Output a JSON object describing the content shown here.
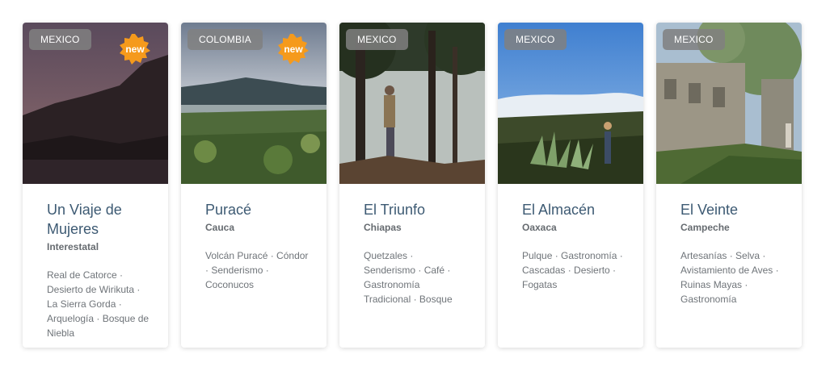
{
  "cards": [
    {
      "country": "MEXICO",
      "badge": "new",
      "title": "Un Viaje de Mujeres",
      "region": "Interestatal",
      "tags": "Real de Catorce · Desierto de Wirikuta · La Sierra Gorda · Arquelogía · Bosque de Niebla"
    },
    {
      "country": "COLOMBIA",
      "badge": "new",
      "title": "Puracé",
      "region": "Cauca",
      "tags": "Volcán Puracé · Cóndor · Senderismo · Coconucos"
    },
    {
      "country": "MEXICO",
      "title": "El Triunfo",
      "region": "Chiapas",
      "tags": "Quetzales · Senderismo · Café · Gastronomía Tradicional · Bosque"
    },
    {
      "country": "MEXICO",
      "title": "El Almacén",
      "region": "Oaxaca",
      "tags": "Pulque · Gastronomía · Cascadas · Desierto · Fogatas"
    },
    {
      "country": "MEXICO",
      "title": "El Veinte",
      "region": "Campeche",
      "tags": "Artesanías · Selva · Avistamiento de Aves · Ruinas Mayas · Gastronomía"
    }
  ],
  "colors": {
    "title": "#3d5a73",
    "badge": "#f59a1c",
    "country_chip": "#808080"
  }
}
